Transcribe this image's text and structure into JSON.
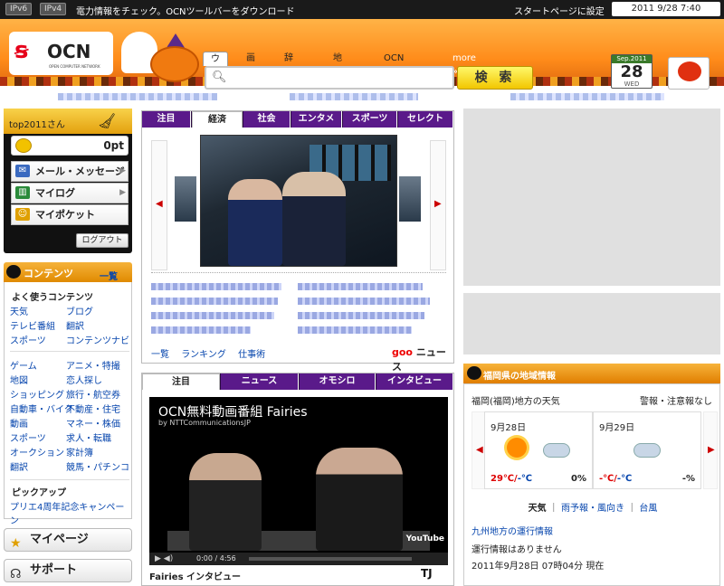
{
  "topbar": {
    "ipv6": "IPv6",
    "ipv4": "IPv4",
    "notice": "電力情報をチェック。OCNツールバーをダウンロード",
    "start_page": "スタートページに設定",
    "datetime": "2011 9/28 7:40"
  },
  "header": {
    "logo_text": "OCN",
    "logo_sub": "OPEN COMPUTER NETWORK",
    "search_tabs": [
      "ウェブ",
      "画像",
      "辞書",
      "地図",
      "OCNサポート",
      "more »"
    ],
    "search_button": "検 索",
    "search_value": "",
    "calendar": {
      "month": "Sep.2011",
      "day": "28",
      "weekday": "WED"
    }
  },
  "user": {
    "name": "top2011さん",
    "points": "0pt",
    "menu": [
      "メール・メッセージ",
      "マイログ",
      "マイポケット"
    ],
    "logout": "ログアウト"
  },
  "contents": {
    "title": "コンテンツ",
    "list_link": "一覧",
    "frequent_title": "よく使うコンテンツ",
    "frequent": [
      [
        "天気",
        "ブログ"
      ],
      [
        "テレビ番組",
        "翻訳"
      ],
      [
        "スポーツ",
        "コンテンツナビ"
      ]
    ],
    "categories": [
      [
        "ゲーム",
        "アニメ・特撮"
      ],
      [
        "地図",
        "恋人探し"
      ],
      [
        "ショッピング",
        "旅行・航空券"
      ],
      [
        "自動車・バイク",
        "不動産・住宅"
      ],
      [
        "動画",
        "マネー・株価"
      ],
      [
        "スポーツ",
        "求人・転職"
      ],
      [
        "オークション",
        "家計簿"
      ],
      [
        "翻訳",
        "競馬・パチンコ"
      ]
    ],
    "pickup_title": "ピックアップ",
    "pickup_link": "プリエ4周年記念キャンペーン"
  },
  "side_buttons": {
    "mypage": "マイページ",
    "support": "サポート"
  },
  "news": {
    "tabs": [
      "注目",
      "経済",
      "社会",
      "エンタメ",
      "スポーツ",
      "セレクト"
    ],
    "active_tab": "経済",
    "links": [
      "一覧",
      "ランキング",
      "仕事術"
    ],
    "source_brand": "goo",
    "source_label": "ニュース"
  },
  "video": {
    "tabs": [
      "注目",
      "ニュース",
      "オモシロ",
      "インタビュー"
    ],
    "title": "OCN無料動画番組 Fairies",
    "channel": "by NTTCommunicationsJP",
    "time": "0:00 / 4:56",
    "yt": "YouTube",
    "caption": "Fairies インタビュー",
    "logo": "TJ"
  },
  "local": {
    "title": "福岡県の地域情報",
    "weather_title": "福岡(福岡)地方の天気",
    "alert": "警報・注意報なし",
    "days": [
      {
        "date": "9月28日",
        "hi": "29℃",
        "lo": "-℃",
        "pop": "0%"
      },
      {
        "date": "9月29日",
        "hi": "-℃",
        "lo": "-℃",
        "pop": "-%"
      }
    ],
    "weather_links": [
      "天気",
      "雨予報・風向き",
      "台風"
    ],
    "rail_title": "九州地方の運行情報",
    "rail_status": "運行情報はありません",
    "rail_time": "2011年9月28日 07時04分 現在"
  },
  "colors": {
    "accent": "#f29a1a",
    "news_tab": "#5a1a8a",
    "brand_red": "#e6001a"
  }
}
